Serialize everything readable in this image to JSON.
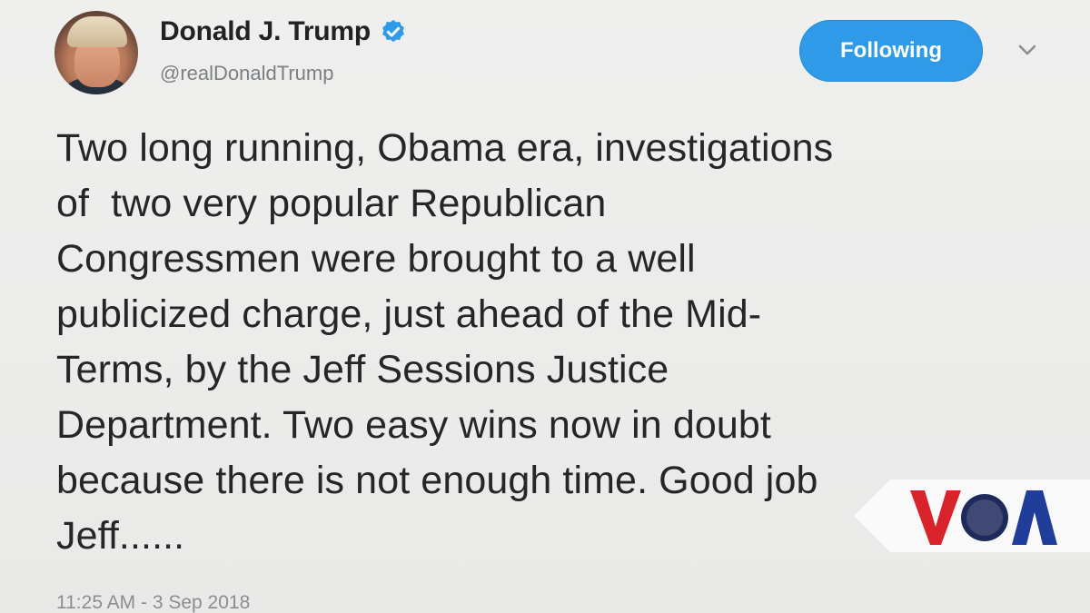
{
  "user": {
    "display_name": "Donald J. Trump",
    "handle": "@realDonaldTrump",
    "verified_icon": "verified-badge-icon"
  },
  "follow_button": {
    "label": "Following"
  },
  "menu_icon": "chevron-down-icon",
  "tweet": {
    "lines": [
      "Two long running, Obama era, investigations",
      "of  two very popular Republican",
      "Congressmen were brought to a well",
      "publicized charge, just ahead of the Mid-",
      "Terms, by the Jeff Sessions Justice",
      "Department. Two easy wins now in doubt",
      "because there is not enough time. Good job",
      "Jeff......"
    ],
    "timestamp": "11:25 AM - 3 Sep 2018"
  },
  "watermark": {
    "logo_text": "VOA"
  },
  "colors": {
    "accent": "#2f9be8",
    "background": "#ebebea",
    "text": "#262626",
    "secondary_text": "#7b7f84"
  }
}
